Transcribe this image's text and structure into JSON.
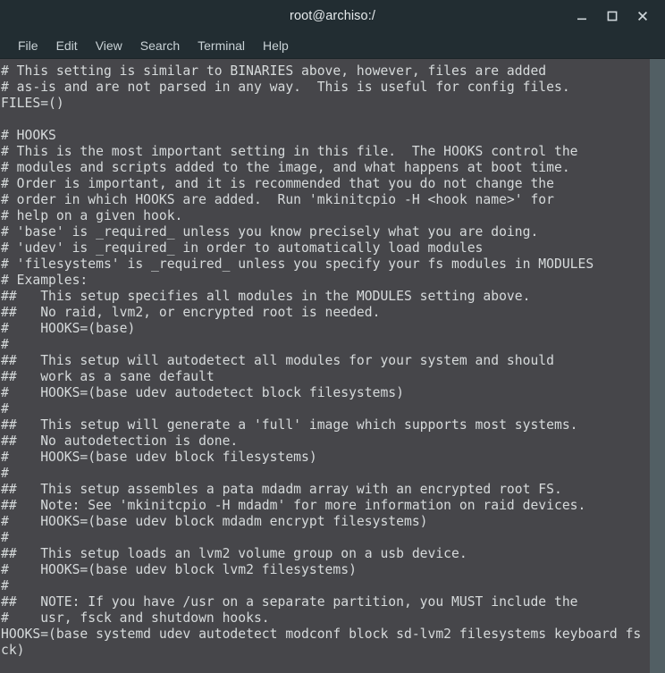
{
  "window": {
    "title": "root@archiso:/",
    "controls": [
      {
        "name": "minimize",
        "glyph": "_"
      },
      {
        "name": "maximize",
        "glyph": "□"
      },
      {
        "name": "close",
        "glyph": "✕"
      }
    ]
  },
  "menubar": {
    "items": [
      {
        "label": "File"
      },
      {
        "label": "Edit"
      },
      {
        "label": "View"
      },
      {
        "label": "Search"
      },
      {
        "label": "Terminal"
      },
      {
        "label": "Help"
      }
    ]
  },
  "terminal": {
    "background_color": "#46464a",
    "foreground_color": "#d6dadb",
    "titlebar_color": "#222d32",
    "scrollbar_color": "#525f64",
    "columns": 81,
    "rows": 38,
    "lines": [
      "# This setting is similar to BINARIES above, however, files are added",
      "# as-is and are not parsed in any way.  This is useful for config files.",
      "FILES=()",
      "",
      "# HOOKS",
      "# This is the most important setting in this file.  The HOOKS control the",
      "# modules and scripts added to the image, and what happens at boot time.",
      "# Order is important, and it is recommended that you do not change the",
      "# order in which HOOKS are added.  Run 'mkinitcpio -H <hook name>' for",
      "# help on a given hook.",
      "# 'base' is _required_ unless you know precisely what you are doing.",
      "# 'udev' is _required_ in order to automatically load modules",
      "# 'filesystems' is _required_ unless you specify your fs modules in MODULES",
      "# Examples:",
      "##   This setup specifies all modules in the MODULES setting above.",
      "##   No raid, lvm2, or encrypted root is needed.",
      "#    HOOKS=(base)",
      "#",
      "##   This setup will autodetect all modules for your system and should",
      "##   work as a sane default",
      "#    HOOKS=(base udev autodetect block filesystems)",
      "#",
      "##   This setup will generate a 'full' image which supports most systems.",
      "##   No autodetection is done.",
      "#    HOOKS=(base udev block filesystems)",
      "#",
      "##   This setup assembles a pata mdadm array with an encrypted root FS.",
      "##   Note: See 'mkinitcpio -H mdadm' for more information on raid devices.",
      "#    HOOKS=(base udev block mdadm encrypt filesystems)",
      "#",
      "##   This setup loads an lvm2 volume group on a usb device.",
      "#    HOOKS=(base udev block lvm2 filesystems)",
      "#",
      "##   NOTE: If you have /usr on a separate partition, you MUST include the",
      "#    usr, fsck and shutdown hooks.",
      "HOOKS=(base systemd udev autodetect modconf block sd-lvm2 filesystems keyboard fs",
      "ck)"
    ]
  }
}
